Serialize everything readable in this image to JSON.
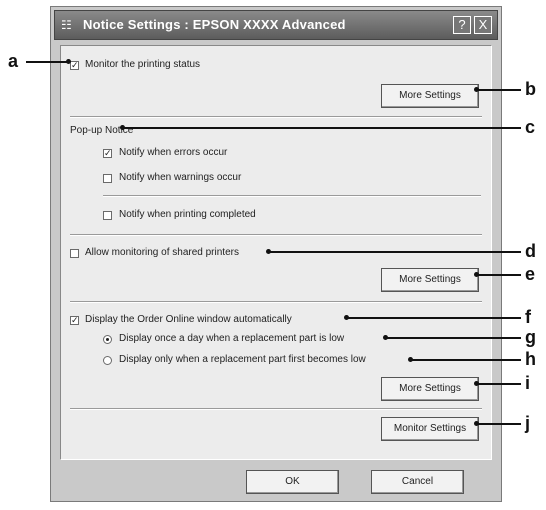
{
  "window": {
    "title": "Notice Settings : EPSON XXXX Advanced",
    "help_symbol": "?",
    "close_symbol": "X"
  },
  "monitor": {
    "label": "Monitor the printing status",
    "checked": true,
    "more_settings": "More Settings"
  },
  "popup": {
    "heading": "Pop-up Notice",
    "items": [
      {
        "label": "Notify when errors occur",
        "checked": true
      },
      {
        "label": "Notify when warnings occur",
        "checked": false
      },
      {
        "label": "Notify when printing completed",
        "checked": false
      }
    ]
  },
  "shared": {
    "label": "Allow monitoring of shared printers",
    "checked": false,
    "more_settings": "More Settings"
  },
  "order": {
    "label": "Display the Order Online window automatically",
    "checked": true,
    "options": [
      {
        "label": "Display once a day when a replacement part is low",
        "selected": true
      },
      {
        "label": "Display only when a replacement part first becomes low",
        "selected": false
      }
    ],
    "more_settings": "More Settings"
  },
  "monitor_settings": "Monitor Settings",
  "buttons": {
    "ok": "OK",
    "cancel": "Cancel"
  },
  "callouts": [
    "a",
    "b",
    "c",
    "d",
    "e",
    "f",
    "g",
    "h",
    "i",
    "j"
  ]
}
